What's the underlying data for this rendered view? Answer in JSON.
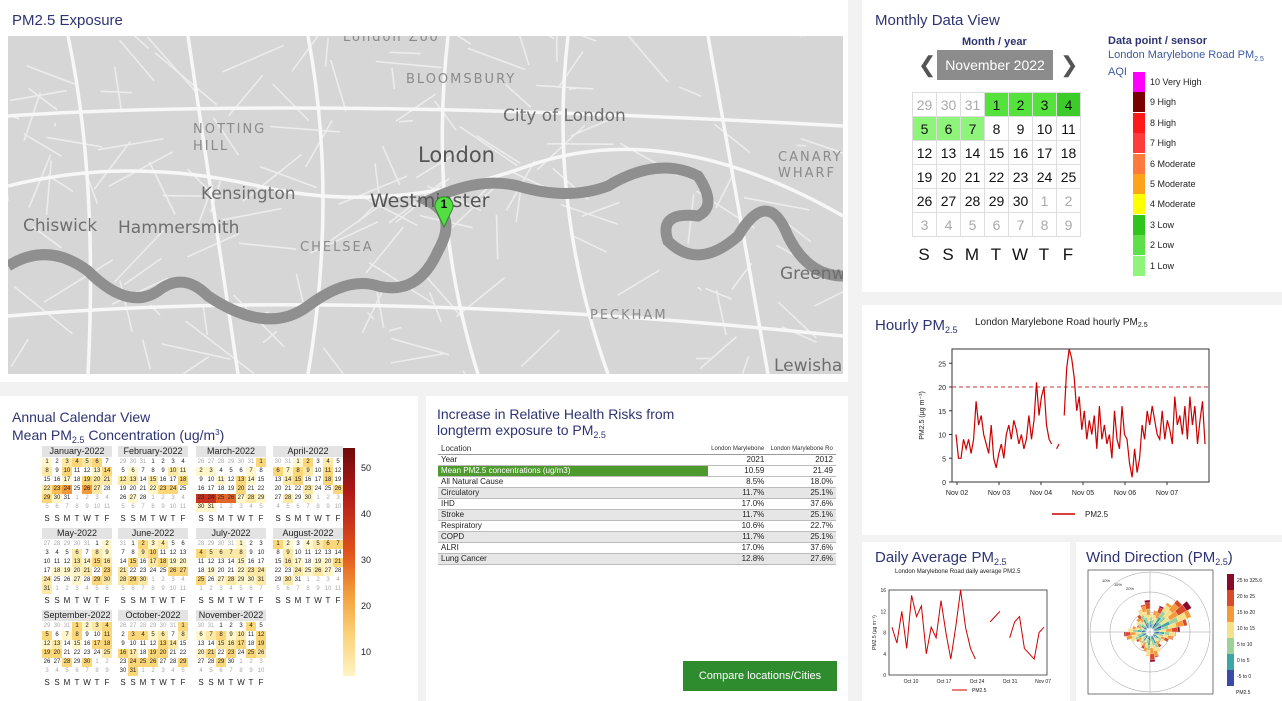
{
  "map": {
    "title": "PM2.5 Exposure",
    "labels": {
      "london": "London",
      "westminster": "Westminster",
      "city": "City of London",
      "bloomsbury": "BLOOMSBURY",
      "notting_hill": "NOTTING\nHILL",
      "kensington": "Kensington",
      "chiswick": "Chiswick",
      "hammersmith": "Hammersmith",
      "chelsea": "CHELSEA",
      "canary": "CANARY\nWHARF",
      "greenwich": "Greenw",
      "peckham": "PECKHAM",
      "lewisham": "Lewishan",
      "top_cut": "London Zoo"
    },
    "marker_label": "1"
  },
  "monthly": {
    "title": "Monthly Data View",
    "month_year_label": "Month / year",
    "current_month": "November 2022",
    "legend_title": "Data point / sensor",
    "legend_sensor": "London Marylebone Road PM",
    "legend_sensor_sub": "2.5",
    "legend_sensor_tail": "AQI",
    "aqi": [
      {
        "label": "10 Very High",
        "color": "#ff00ff"
      },
      {
        "label": "9 High",
        "color": "#7a0000"
      },
      {
        "label": "8 High",
        "color": "#ff1a1a"
      },
      {
        "label": "7 High",
        "color": "#ff3c3c"
      },
      {
        "label": "6 Moderate",
        "color": "#ff7a3c"
      },
      {
        "label": "5 Moderate",
        "color": "#ffa31a"
      },
      {
        "label": "4 Moderate",
        "color": "#ffff00"
      },
      {
        "label": "3 Low",
        "color": "#2fc41e"
      },
      {
        "label": "2 Low",
        "color": "#5fe04a"
      },
      {
        "label": "1 Low",
        "color": "#8ff57a"
      }
    ],
    "weeks": [
      [
        {
          "d": "29",
          "c": "dim"
        },
        {
          "d": "30",
          "c": "dim"
        },
        {
          "d": "31",
          "c": "dim"
        },
        {
          "d": "1",
          "c": "g2"
        },
        {
          "d": "2",
          "c": "g2"
        },
        {
          "d": "3",
          "c": "g2"
        },
        {
          "d": "4",
          "c": "g3"
        }
      ],
      [
        {
          "d": "5",
          "c": "g1"
        },
        {
          "d": "6",
          "c": "g1"
        },
        {
          "d": "7",
          "c": "g1"
        },
        {
          "d": "8",
          "c": ""
        },
        {
          "d": "9",
          "c": ""
        },
        {
          "d": "10",
          "c": ""
        },
        {
          "d": "11",
          "c": ""
        }
      ],
      [
        {
          "d": "12",
          "c": ""
        },
        {
          "d": "13",
          "c": ""
        },
        {
          "d": "14",
          "c": ""
        },
        {
          "d": "15",
          "c": ""
        },
        {
          "d": "16",
          "c": ""
        },
        {
          "d": "17",
          "c": ""
        },
        {
          "d": "18",
          "c": ""
        }
      ],
      [
        {
          "d": "19",
          "c": ""
        },
        {
          "d": "20",
          "c": ""
        },
        {
          "d": "21",
          "c": ""
        },
        {
          "d": "22",
          "c": ""
        },
        {
          "d": "23",
          "c": ""
        },
        {
          "d": "24",
          "c": ""
        },
        {
          "d": "25",
          "c": ""
        }
      ],
      [
        {
          "d": "26",
          "c": ""
        },
        {
          "d": "27",
          "c": ""
        },
        {
          "d": "28",
          "c": ""
        },
        {
          "d": "29",
          "c": ""
        },
        {
          "d": "30",
          "c": ""
        },
        {
          "d": "1",
          "c": "dim"
        },
        {
          "d": "2",
          "c": "dim"
        }
      ],
      [
        {
          "d": "3",
          "c": "dim"
        },
        {
          "d": "4",
          "c": "dim"
        },
        {
          "d": "5",
          "c": "dim"
        },
        {
          "d": "6",
          "c": "dim"
        },
        {
          "d": "7",
          "c": "dim"
        },
        {
          "d": "8",
          "c": "dim"
        },
        {
          "d": "9",
          "c": "dim"
        }
      ]
    ],
    "day_headers": [
      "S",
      "S",
      "M",
      "T",
      "W",
      "T",
      "F"
    ]
  },
  "hourly": {
    "title": "Hourly PM",
    "title_sub": "2.5",
    "chart_title": "London Marylebone Road hourly PM",
    "chart_title_sub": "2.5",
    "ylabel": "PM2.5 (µg m⁻³)",
    "legend": "PM2.5",
    "xticks": [
      "Nov 02",
      "Nov 03",
      "Nov 04",
      "Nov 05",
      "Nov 06",
      "Nov 07"
    ],
    "yticks": [
      "0",
      "5",
      "10",
      "15",
      "20",
      "25"
    ]
  },
  "annual": {
    "title_line1": "Annual Calendar View",
    "title_line2": "Mean PM",
    "title_line2_sub": "2.5",
    "title_line2_tail": " Concentration (ug/m",
    "title_line2_sup": "3",
    "title_line2_end": ")",
    "months": [
      "January-2022",
      "February-2022",
      "March-2022",
      "April-2022",
      "May-2022",
      "June-2022",
      "July-2022",
      "August-2022",
      "September-2022",
      "October-2022",
      "November-2022"
    ],
    "day_headers": [
      "S",
      "S",
      "M",
      "T",
      "W",
      "T",
      "F"
    ],
    "scale": [
      "50",
      "40",
      "30",
      "20",
      "10"
    ]
  },
  "health": {
    "title_line1": "Increase in Relative Health Risks from",
    "title_line2": "longterm exposure to PM",
    "title_sub": "2.5",
    "headers": [
      "Location",
      "London Marylebone",
      "London Marylebone Ro"
    ],
    "rows": [
      {
        "k": "Year",
        "a": "2021",
        "b": "2012",
        "cls": ""
      },
      {
        "k": "Mean PM2.5 concentrations (ug/m3)",
        "a": "10.59",
        "b": "21.49",
        "cls": "green"
      },
      {
        "k": "All Natural Cause",
        "a": "8.5%",
        "b": "18.0%",
        "cls": ""
      },
      {
        "k": "Circulatory",
        "a": "11.7%",
        "b": "25.1%",
        "cls": "shade"
      },
      {
        "k": "IHD",
        "a": "17.0%",
        "b": "37.6%",
        "cls": ""
      },
      {
        "k": "Stroke",
        "a": "11.7%",
        "b": "25.1%",
        "cls": "shade"
      },
      {
        "k": "Respiratory",
        "a": "10.6%",
        "b": "22.7%",
        "cls": ""
      },
      {
        "k": "COPD",
        "a": "11.7%",
        "b": "25.1%",
        "cls": "shade"
      },
      {
        "k": "ALRI",
        "a": "17.0%",
        "b": "37.6%",
        "cls": ""
      },
      {
        "k": "Lung Cancer",
        "a": "12.8%",
        "b": "27.6%",
        "cls": "shade"
      }
    ],
    "compare_button": "Compare locations/Cities"
  },
  "daily": {
    "title": "Daily Average PM",
    "title_sub": "2.5",
    "chart_title": "London Marylebone Road daily average PM2.5",
    "xticks": [
      "Oct 10",
      "Oct 17",
      "Oct 24",
      "Oct 31",
      "Nov 07"
    ],
    "yticks": [
      "0",
      "4",
      "8",
      "12",
      "16"
    ],
    "ylabel": "PM2.5 (µg m⁻³)",
    "legend": "PM2.5"
  },
  "wind": {
    "title": "Wind Direction (PM",
    "title_sub": "2.5",
    "title_end": ")",
    "scale": [
      {
        "label": "25 to 325.6",
        "color": "#8a0a2a"
      },
      {
        "label": "20 to 25",
        "color": "#d94a2a"
      },
      {
        "label": "15 to 20",
        "color": "#f59a3a"
      },
      {
        "label": "10 to 15",
        "color": "#f7e08a"
      },
      {
        "label": "5 to 10",
        "color": "#9ed09a"
      },
      {
        "label": "0 to 5",
        "color": "#3aa6a6"
      },
      {
        "label": "-5 to 0",
        "color": "#3a4aa6"
      }
    ],
    "scale_footer": "PM2.5",
    "pct_labels": [
      "10%",
      "15%",
      "20%"
    ]
  },
  "chart_data": [
    {
      "type": "line",
      "title": "London Marylebone Road hourly PM2.5",
      "ylabel": "PM2.5 (µg m⁻³)",
      "xlabel": "",
      "x_categories": [
        "Nov 02",
        "Nov 03",
        "Nov 04",
        "Nov 05",
        "Nov 06",
        "Nov 07"
      ],
      "ylim": [
        0,
        28
      ],
      "reference_line": 20,
      "series": [
        {
          "name": "PM2.5",
          "color": "#cc0000",
          "values": [
            10,
            5,
            5,
            9,
            7,
            9,
            6,
            9,
            17,
            12,
            14,
            10,
            8,
            6,
            12,
            5,
            3,
            6,
            8,
            5,
            10,
            12,
            9,
            13,
            11,
            8,
            10,
            7,
            9,
            14,
            9,
            13,
            21,
            14,
            18,
            20,
            12,
            9,
            8,
            null,
            7,
            8,
            null,
            14,
            24,
            28,
            26,
            22,
            15,
            18,
            11,
            15,
            9,
            13,
            10,
            14,
            7,
            16,
            9,
            12,
            8,
            10,
            5,
            15,
            9,
            7,
            16,
            10,
            9,
            4,
            1,
            7,
            2,
            5,
            12,
            9,
            15,
            12,
            16,
            13,
            10,
            9,
            15,
            9,
            13,
            11,
            8,
            18,
            12,
            14,
            10,
            16,
            9,
            18,
            12,
            16,
            8,
            13,
            17,
            8
          ]
        }
      ]
    },
    {
      "type": "line",
      "title": "London Marylebone Road daily average PM2.5",
      "x_categories": [
        "Oct 10",
        "Oct 17",
        "Oct 24",
        "Oct 31",
        "Nov 07"
      ],
      "ylim": [
        0,
        16
      ],
      "series": [
        {
          "name": "PM2.5",
          "color": "#cc0000",
          "values": [
            9,
            6,
            12,
            5,
            15,
            11,
            13,
            4,
            9,
            7,
            14,
            8,
            3,
            9,
            16,
            9,
            5,
            3,
            null,
            null,
            10,
            11,
            12,
            null,
            7,
            10,
            11,
            5,
            4,
            3,
            8,
            9
          ]
        }
      ]
    }
  ]
}
